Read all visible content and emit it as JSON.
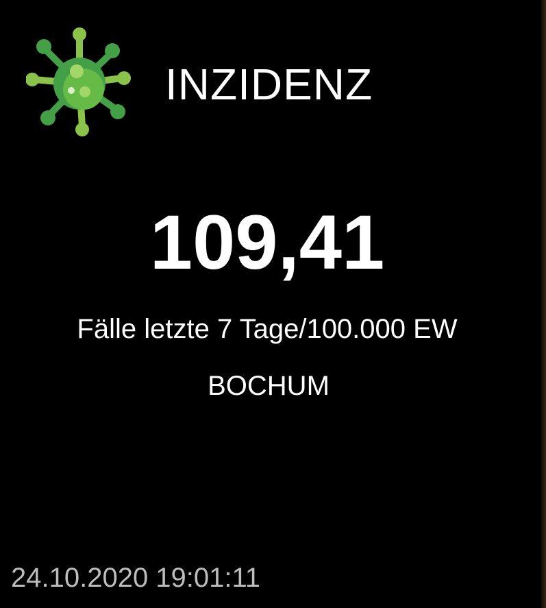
{
  "header": {
    "icon": "virus-icon",
    "title": "INZIDENZ"
  },
  "incidence": {
    "value": "109,41",
    "unit_label": "Fälle letzte 7 Tage/100.000 EW",
    "city": "BOCHUM"
  },
  "footer": {
    "timestamp": "24.10.2020 19:01:11"
  },
  "colors": {
    "background": "#000000",
    "text": "#ffffff",
    "timestamp_text": "#bdbdbd",
    "icon_dark_green": "#43a047",
    "icon_light_green": "#8bc34a"
  }
}
